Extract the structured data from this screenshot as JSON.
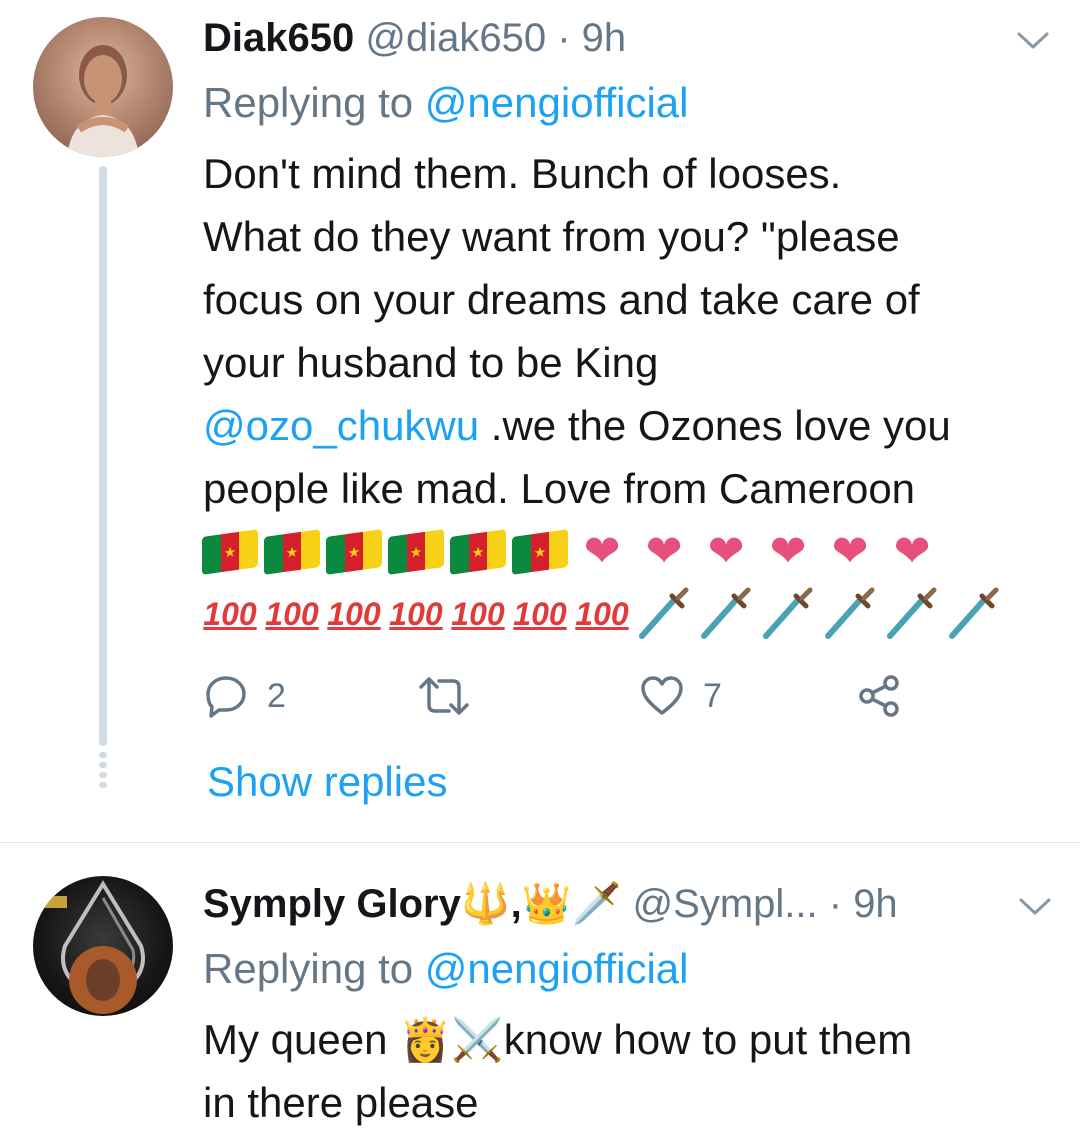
{
  "tweets": [
    {
      "display_name": "Diak650",
      "handle": "@diak650",
      "separator": "·",
      "time": "9h",
      "replying_prefix": "Replying to ",
      "replying_to": "@nengiofficial",
      "body_lines": [
        "Don't mind them. Bunch of looses.",
        "What do they want from you? \"please",
        "focus on your dreams and take care of",
        "your husband to be King"
      ],
      "body_mention": "@ozo_chukwu",
      "body_after_mention": " .we the Ozones love you",
      "body_last_line": "people like mad. Love from Cameroon",
      "emoji_row1": "🇨🇲🇨🇲🇨🇲🇨🇲🇨🇲🇨🇲💓💓💓💓💓💓",
      "emoji_row2": "💯💯💯💯💯💯💯🗡️🗡️🗡️🗡️🗡️🗡️",
      "reply_count": "2",
      "like_count": "7",
      "show_replies": "Show replies"
    },
    {
      "display_name": "Symply Glory🔱,👑🗡️",
      "handle": "@Sympl...",
      "separator": "·",
      "time": "9h",
      "replying_prefix": "Replying to ",
      "replying_to": "@nengiofficial",
      "body_line1_text_a": "My queen ",
      "body_line1_emoji": "👸⚔️",
      "body_line1_text_b": "know how to put them",
      "body_line2": "in there please"
    }
  ],
  "icons": {
    "reply": "reply-icon",
    "retweet": "retweet-icon",
    "like": "heart-icon",
    "share": "share-icon",
    "more": "chevron-down-icon"
  },
  "colors": {
    "link": "#1da1f2",
    "muted": "#657786",
    "text": "#14171a",
    "thread_line": "#d2dbe2"
  }
}
